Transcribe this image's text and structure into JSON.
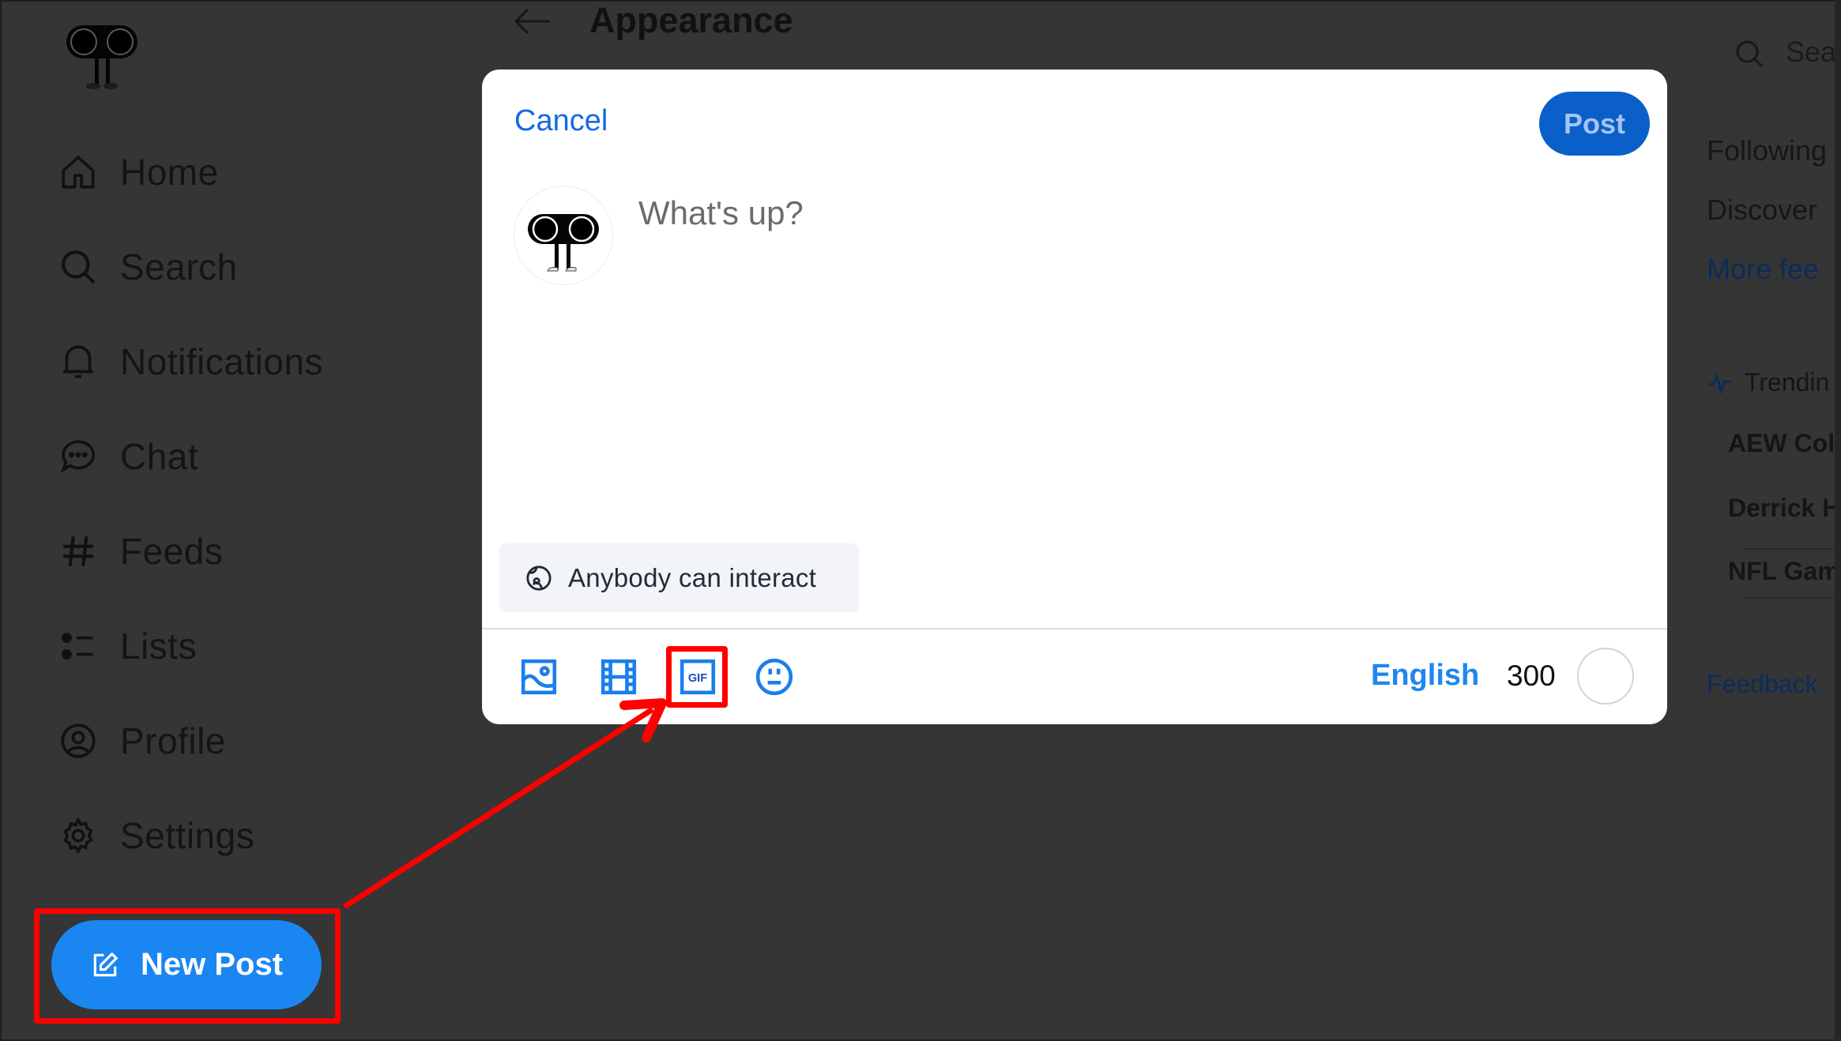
{
  "header": {
    "title": "Appearance"
  },
  "sidebar": {
    "items": [
      {
        "label": "Home",
        "icon": "home-icon"
      },
      {
        "label": "Search",
        "icon": "search-icon"
      },
      {
        "label": "Notifications",
        "icon": "bell-icon"
      },
      {
        "label": "Chat",
        "icon": "chat-icon"
      },
      {
        "label": "Feeds",
        "icon": "hashtag-icon"
      },
      {
        "label": "Lists",
        "icon": "list-icon"
      },
      {
        "label": "Profile",
        "icon": "profile-icon"
      },
      {
        "label": "Settings",
        "icon": "gear-icon"
      }
    ],
    "new_post_label": "New Post"
  },
  "right_panel": {
    "search_placeholder": "Sea",
    "feeds": [
      "Following",
      "Discover"
    ],
    "more_feeds": "More fee",
    "trending_label": "Trendin",
    "trending": [
      "AEW Coll",
      "Derrick H",
      "NFL Gam"
    ],
    "feedback": "Feedback"
  },
  "composer": {
    "cancel_label": "Cancel",
    "post_label": "Post",
    "placeholder": "What's up?",
    "interaction_setting": "Anybody can interact",
    "tools": [
      {
        "name": "image-icon"
      },
      {
        "name": "video-icon"
      },
      {
        "name": "gif-icon",
        "glyph": "GIF"
      },
      {
        "name": "emoji-icon"
      }
    ],
    "language": "English",
    "chars_remaining": "300"
  },
  "annotation": {
    "highlight_color": "#ff0000"
  },
  "colors": {
    "accent": "#1a86f2",
    "post_button": "#0b5fc9",
    "link_blue": "#1469e4"
  }
}
